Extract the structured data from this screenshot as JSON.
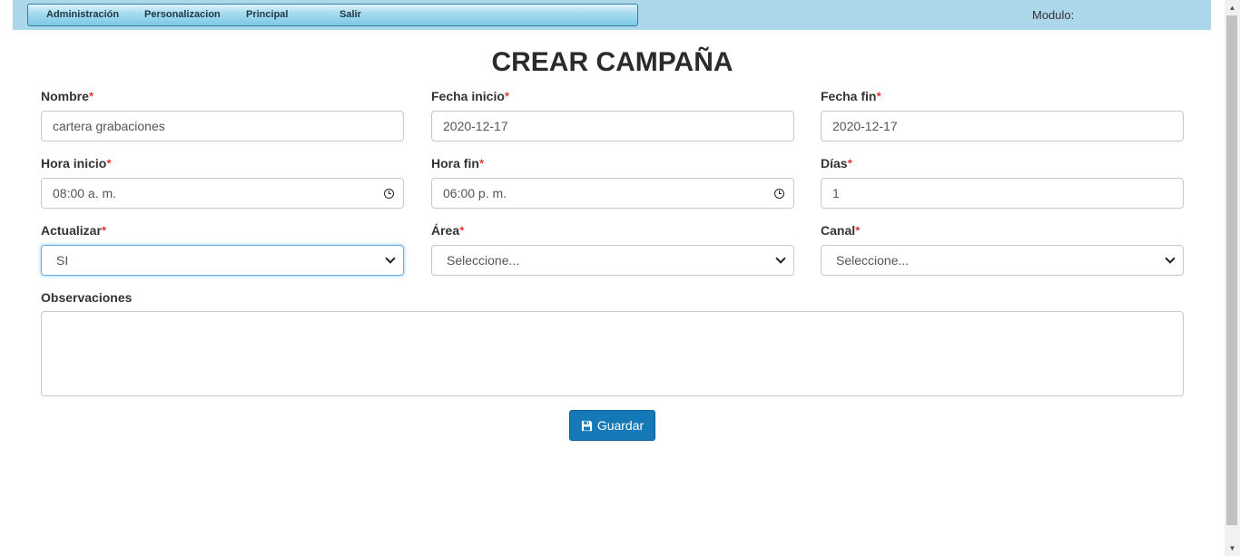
{
  "menu": {
    "items": [
      {
        "label": "Administración"
      },
      {
        "label": "Personalizacion"
      },
      {
        "label": "Principal"
      },
      {
        "label": "Salir"
      }
    ],
    "modulo_label": "Modulo:"
  },
  "page_title": "CREAR CAMPAÑA",
  "required_mark": "*",
  "form": {
    "nombre": {
      "label": "Nombre",
      "value": "cartera grabaciones"
    },
    "fecha_inicio": {
      "label": "Fecha inicio",
      "value": "2020-12-17"
    },
    "fecha_fin": {
      "label": "Fecha fin",
      "value": "2020-12-17"
    },
    "hora_inicio": {
      "label": "Hora inicio",
      "value": "08:00 a. m.",
      "icon": "clock-icon"
    },
    "hora_fin": {
      "label": "Hora fin",
      "value": "06:00 p. m.",
      "icon": "clock-icon"
    },
    "dias": {
      "label": "Días",
      "value": "1"
    },
    "actualizar": {
      "label": "Actualizar",
      "value": "SI"
    },
    "area": {
      "label": "Área",
      "value": "Seleccione..."
    },
    "canal": {
      "label": "Canal",
      "value": "Seleccione..."
    },
    "observaciones": {
      "label": "Observaciones",
      "value": ""
    }
  },
  "save_button": {
    "label": "Guardar",
    "icon": "save-icon",
    "color": "#1679b7"
  },
  "colors": {
    "topbar": "#acd7ea",
    "required": "#dd0000",
    "focus_border": "#66afe9"
  }
}
